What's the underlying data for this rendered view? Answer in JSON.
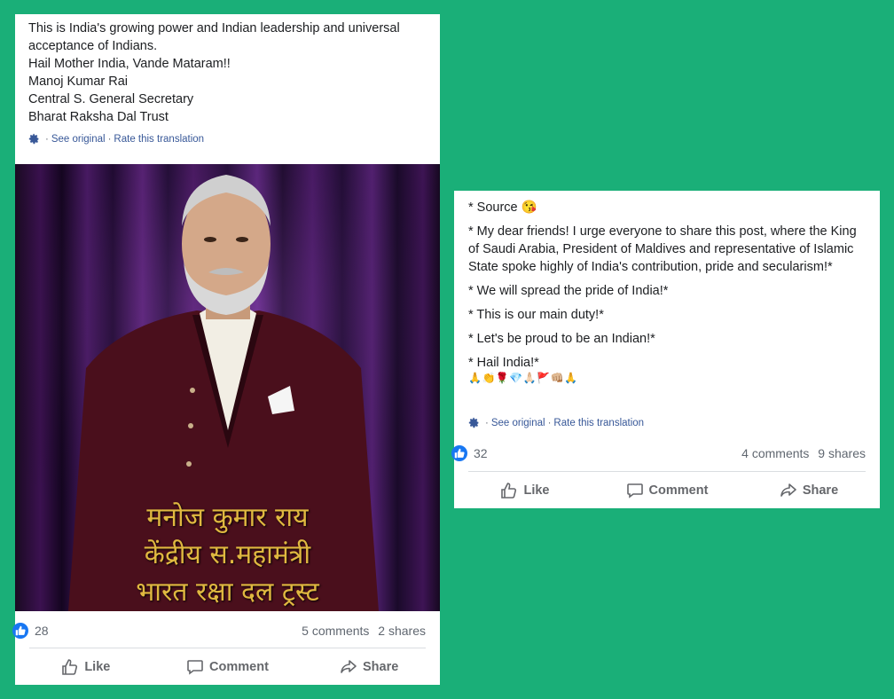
{
  "post1": {
    "text_lines": [
      "This is India's growing power and Indian leadership and universal acceptance of Indians.",
      "Hail Mother India, Vande Mataram!!",
      "Manoj Kumar Rai",
      "Central S. General Secretary",
      "Bharat Raksha Dal Trust"
    ],
    "see_original": "See original",
    "rate_translation": "Rate this translation",
    "separator": "·",
    "image_caption_lines": [
      "मनोज कुमार राय",
      "केंद्रीय स.महामंत्री",
      "भारत रक्षा दल ट्रस्ट"
    ],
    "likes": "28",
    "comments": "5 comments",
    "shares": "2 shares",
    "actions": {
      "like": "Like",
      "comment": "Comment",
      "share": "Share"
    }
  },
  "post2": {
    "paragraphs": [
      "* Source 😘",
      "* My dear friends! I urge everyone to share this post, where the King of Saudi Arabia, President of Maldives and representative of Islamic State spoke highly of India's contribution, pride and secularism!*",
      "* We will spread the pride of India!*",
      "* This is our main duty!*",
      "* Let's be proud to be an Indian!*",
      "* Hail India!*"
    ],
    "emojis": "🙏👏🌹💎🙏🏻🚩👊🏼🙏",
    "see_original": "See original",
    "rate_translation": "Rate this translation",
    "separator": "·",
    "likes": "32",
    "comments": "4 comments",
    "shares": "9 shares",
    "actions": {
      "like": "Like",
      "comment": "Comment",
      "share": "Share"
    }
  },
  "colors": {
    "background": "#1aaf78",
    "link": "#385898",
    "like_blue": "#1877f2",
    "caption_gold": "#e0b840"
  }
}
